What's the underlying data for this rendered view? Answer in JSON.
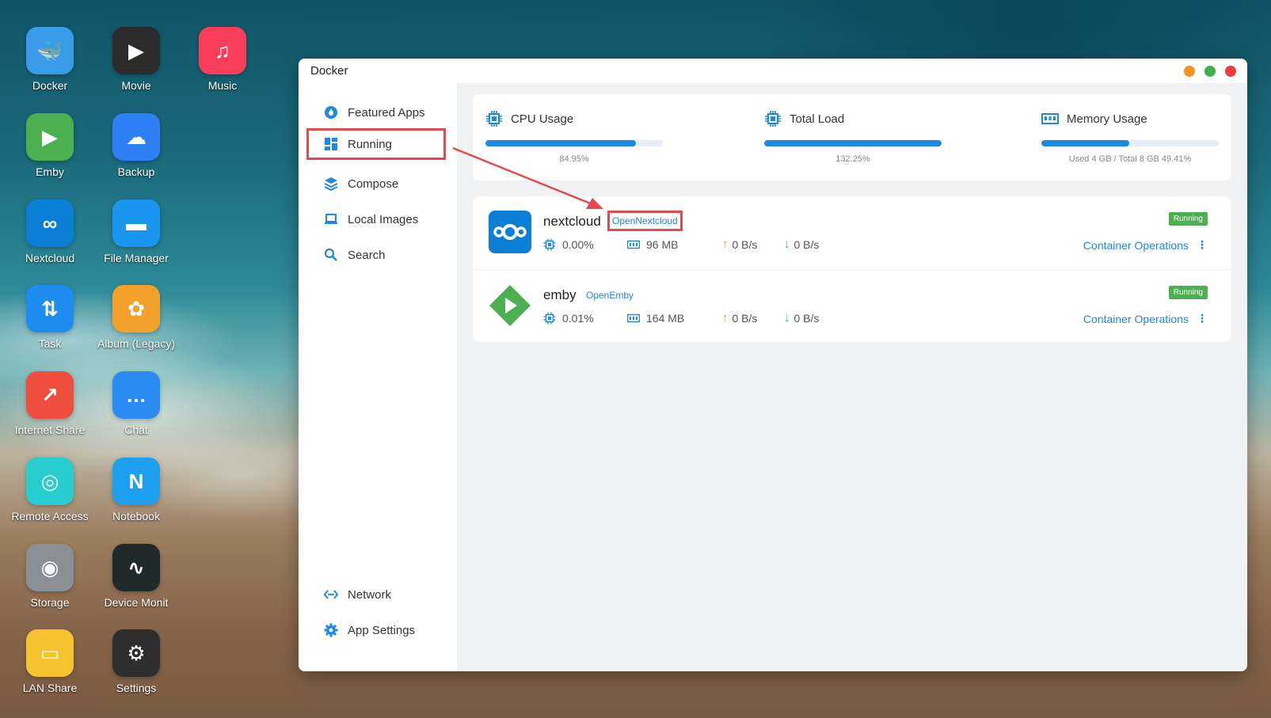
{
  "desktop": {
    "icons": [
      {
        "label": "Docker",
        "icon": "docker-whale-icon",
        "color": "#3a9be8"
      },
      {
        "label": "Movie",
        "icon": "clapperboard-icon",
        "color": "#2b2b2b"
      },
      {
        "label": "Music",
        "icon": "music-note-icon",
        "color": "#fa3d58"
      },
      {
        "label": "Emby",
        "icon": "emby-play-icon",
        "color": "#4caf50"
      },
      {
        "label": "Backup",
        "icon": "cloud-backup-icon",
        "color": "#2f7ff5"
      },
      {
        "label": "Nextcloud",
        "icon": "nextcloud-icon",
        "color": "#0b7ed6"
      },
      {
        "label": "File Manager",
        "icon": "folder-icon",
        "color": "#1a96f0"
      },
      {
        "label": "Task",
        "icon": "transfer-arrows-icon",
        "color": "#1f8cf2"
      },
      {
        "label": "Album (Legacy)",
        "icon": "photos-flower-icon",
        "color": "#f3a12c"
      },
      {
        "label": "Internet Share",
        "icon": "share-arrow-icon",
        "color": "#f04e3e"
      },
      {
        "label": "Chat",
        "icon": "chat-bubble-icon",
        "color": "#2a8bf2"
      },
      {
        "label": "Remote Access",
        "icon": "antenna-icon",
        "color": "#28cdd0"
      },
      {
        "label": "Notebook",
        "icon": "notebook-icon",
        "color": "#1f9ff0"
      },
      {
        "label": "Storage",
        "icon": "hard-drive-icon",
        "color": "#8a8f96"
      },
      {
        "label": "Device Monit",
        "icon": "heartbeat-monitor-icon",
        "color": "#1f2b2b"
      },
      {
        "label": "LAN Share",
        "icon": "shared-folder-icon",
        "color": "#f6c32e"
      },
      {
        "label": "Settings",
        "icon": "gear-icon",
        "color": "#2e2e2e"
      }
    ]
  },
  "window": {
    "title": "Docker",
    "traffic": {
      "minimize": "#f6921e",
      "maximize": "#3cb34a",
      "close": "#ee3b3b"
    }
  },
  "sidebar": {
    "items": [
      {
        "label": "Featured Apps",
        "icon": "fire-icon"
      },
      {
        "label": "Running",
        "icon": "dashboard-icon"
      },
      {
        "label": "Compose",
        "icon": "layers-icon"
      },
      {
        "label": "Local Images",
        "icon": "laptop-icon"
      },
      {
        "label": "Search",
        "icon": "search-icon"
      }
    ],
    "bottom_items": [
      {
        "label": "Network",
        "icon": "network-icon"
      },
      {
        "label": "App Settings",
        "icon": "gear-icon"
      }
    ]
  },
  "stats": {
    "cpu": {
      "label": "CPU Usage",
      "value": "84.95%",
      "fraction": 0.8495
    },
    "load": {
      "label": "Total Load",
      "value": "132.25%",
      "fraction": 1.0
    },
    "memory": {
      "label": "Memory Usage",
      "value": "Used 4 GB / Total 8 GB  49.41%",
      "fraction": 0.4941
    }
  },
  "apps": [
    {
      "name": "nextcloud",
      "open_label": "OpenNextcloud",
      "status": "Running",
      "cpu": "0.00%",
      "memory": "96 MB",
      "upload": "0 B/s",
      "download": "0 B/s",
      "ops_label": "Container Operations"
    },
    {
      "name": "emby",
      "open_label": "OpenEmby",
      "status": "Running",
      "cpu": "0.01%",
      "memory": "164 MB",
      "upload": "0 B/s",
      "download": "0 B/s",
      "ops_label": "Container Operations"
    }
  ],
  "accent": "#1e88e5",
  "highlight": "#e5484d",
  "status_color": "#4caf50"
}
